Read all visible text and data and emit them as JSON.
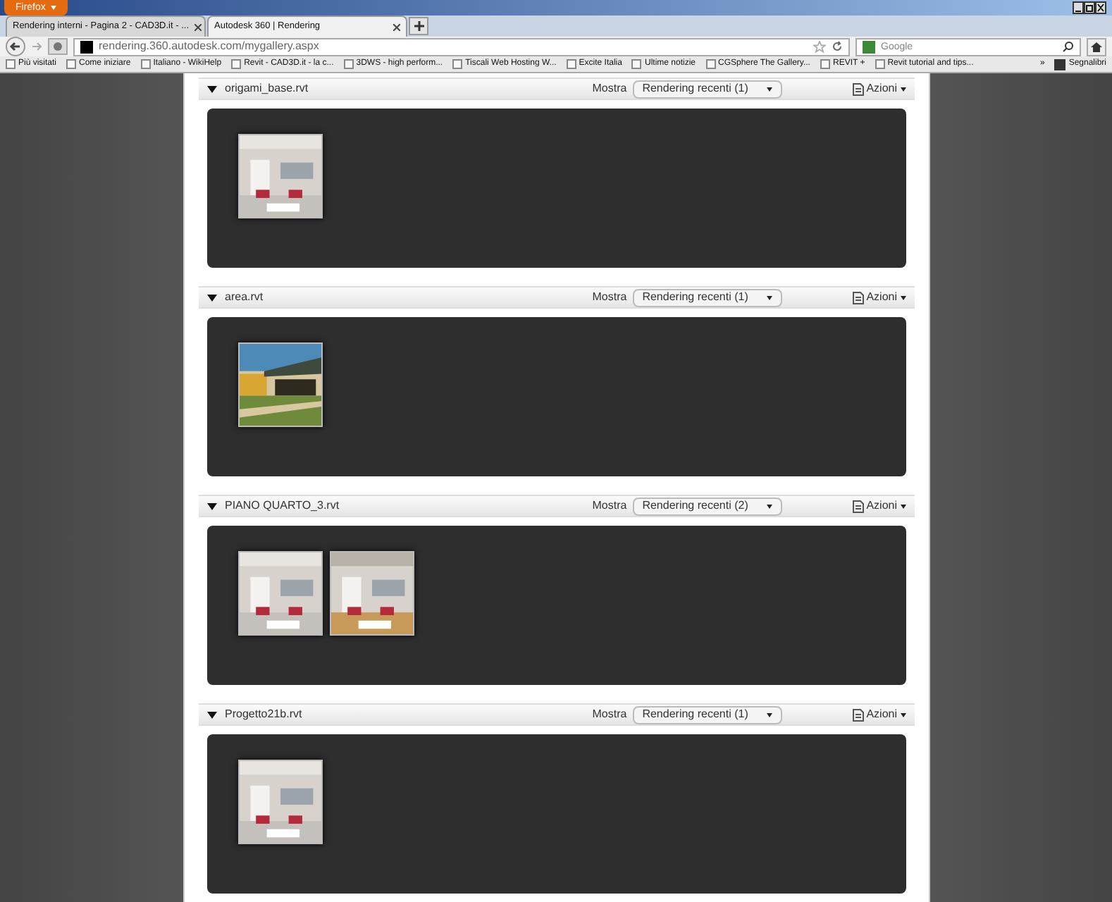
{
  "browser": {
    "app_button": "Firefox",
    "tabs": [
      {
        "label": "Rendering interni - Pagina 2 - CAD3D.it - ...",
        "selected": false
      },
      {
        "label": "Autodesk 360 | Rendering",
        "selected": true
      }
    ],
    "url": "rendering.360.autodesk.com/mygallery.aspx",
    "search": {
      "placeholder": "Google"
    },
    "bookmarks": [
      "Più visitati",
      "Come iniziare",
      "Italiano - WikiHelp",
      "Revit - CAD3D.it - la c...",
      "3DWS - high perform...",
      "Tiscali Web Hosting W...",
      "Excite Italia",
      "Ultime notizie",
      "CGSphere The Gallery...",
      "REVIT +",
      "Revit tutorial and tips..."
    ],
    "more": "»",
    "bookmarks_menu": "Segnalibri"
  },
  "projects": [
    {
      "name": "origami_base.rvt",
      "show_label": "Mostra",
      "filter": "Rendering recenti (1)",
      "actions": "Azioni",
      "expanded": true,
      "renderings": [
        {
          "kind": "interior"
        }
      ]
    },
    {
      "name": "area.rvt",
      "show_label": "Mostra",
      "filter": "Rendering recenti (1)",
      "actions": "Azioni",
      "expanded": true,
      "renderings": [
        {
          "kind": "exterior"
        }
      ]
    },
    {
      "name": "PIANO QUARTO_3.rvt",
      "show_label": "Mostra",
      "filter": "Rendering recenti (2)",
      "actions": "Azioni",
      "expanded": true,
      "renderings": [
        {
          "kind": "interior"
        },
        {
          "kind": "interior"
        }
      ]
    },
    {
      "name": "Progetto21b.rvt",
      "show_label": "Mostra",
      "filter": "Rendering recenti (1)",
      "actions": "Azioni",
      "expanded": true,
      "renderings": [
        {
          "kind": "interior"
        }
      ]
    }
  ]
}
